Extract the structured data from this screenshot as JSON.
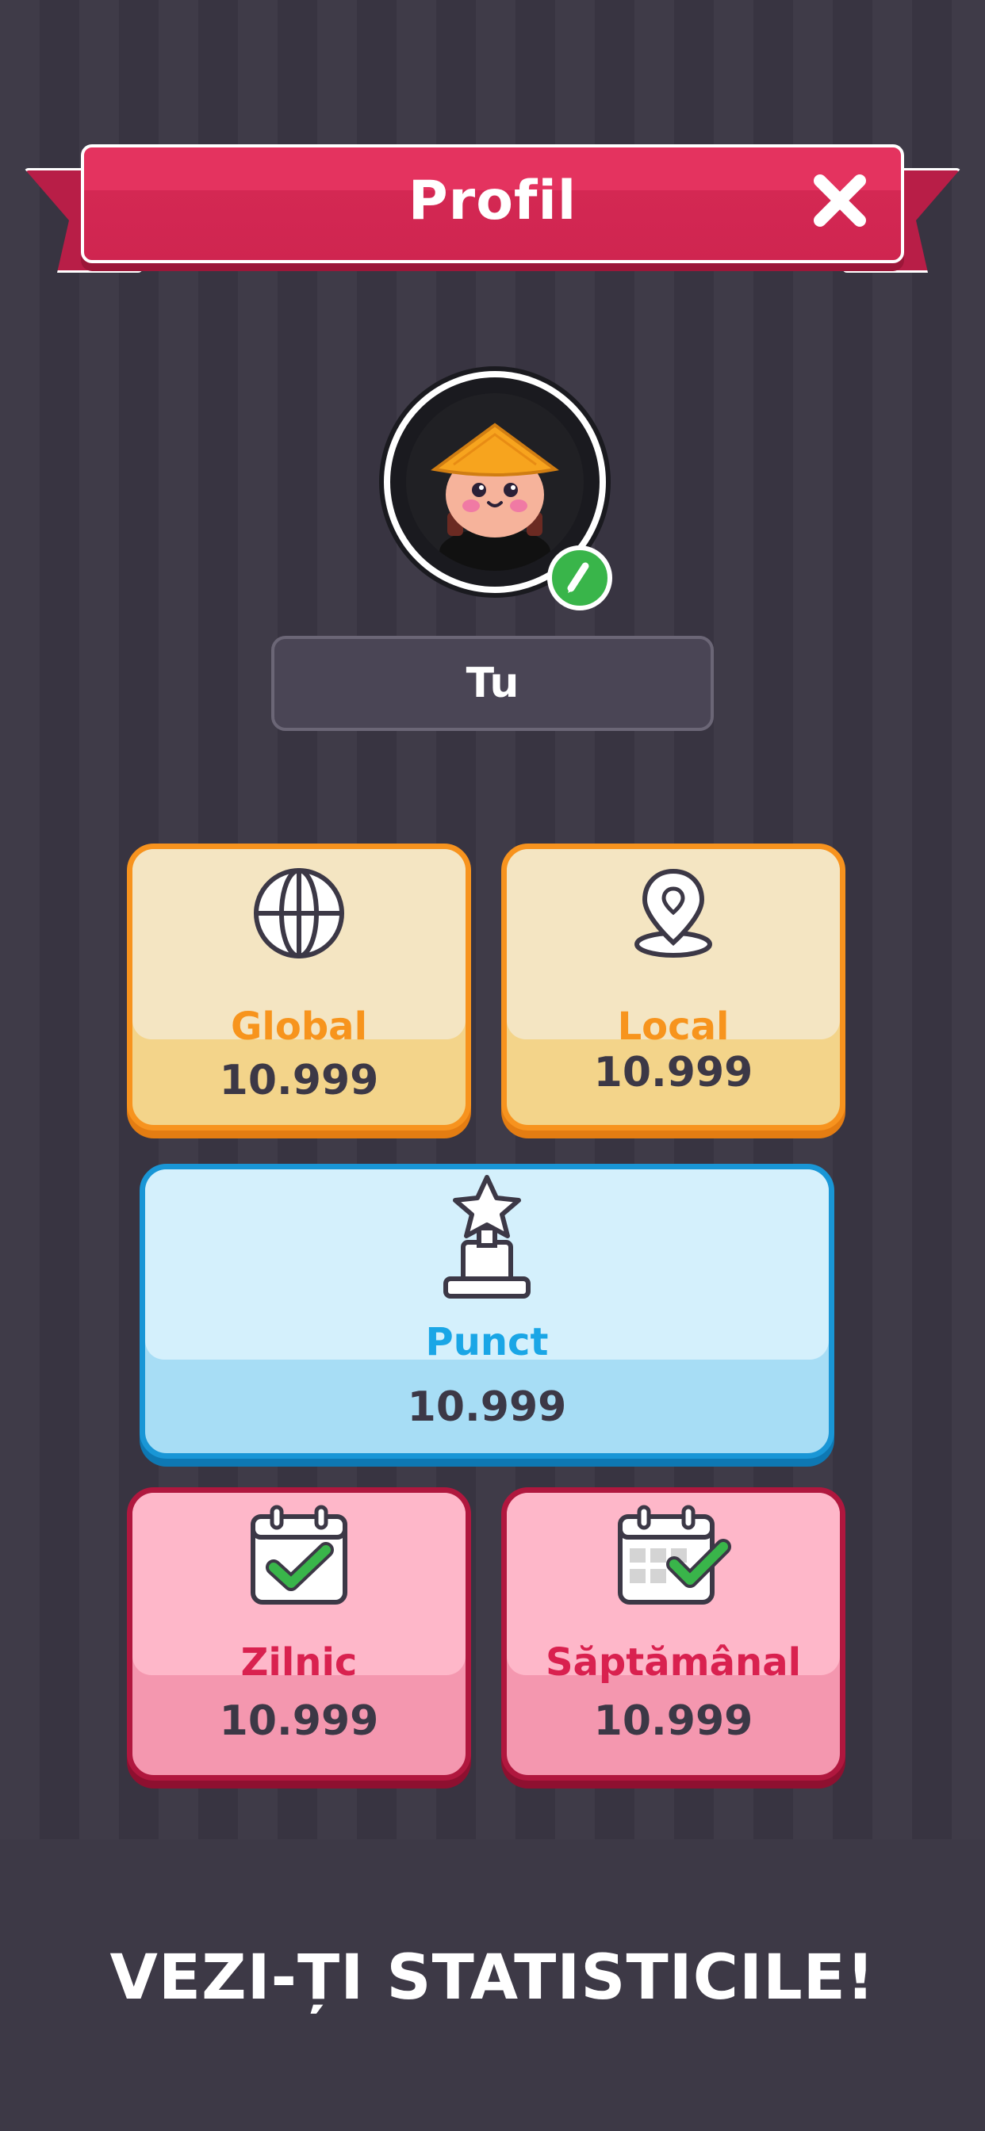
{
  "header": {
    "title": "Profil",
    "close_label": "X"
  },
  "profile": {
    "name": "Tu",
    "avatar": "ninja-hat-avatar",
    "edit_icon": "pencil-icon"
  },
  "stats": {
    "global": {
      "label": "Global",
      "value": "10.999",
      "icon": "globe-icon"
    },
    "local": {
      "label": "Local",
      "value": "10.999",
      "icon": "location-pin-icon"
    },
    "punct": {
      "label": "Punct",
      "value": "10.999",
      "icon": "trophy-star-icon"
    },
    "zilnic": {
      "label": "Zilnic",
      "value": "10.999",
      "icon": "calendar-check-icon"
    },
    "saptamanal": {
      "label": "Săptămânal",
      "value": "10.999",
      "icon": "calendar-week-check-icon"
    }
  },
  "footer": {
    "caption": "VEZI-ȚI STATISTICILE!"
  },
  "colors": {
    "background": "#3e3a47",
    "ribbon": "#e4335f",
    "orange": "#f7941d",
    "blue": "#1aa6e6",
    "pink": "#d9214f",
    "green": "#39b54a"
  }
}
